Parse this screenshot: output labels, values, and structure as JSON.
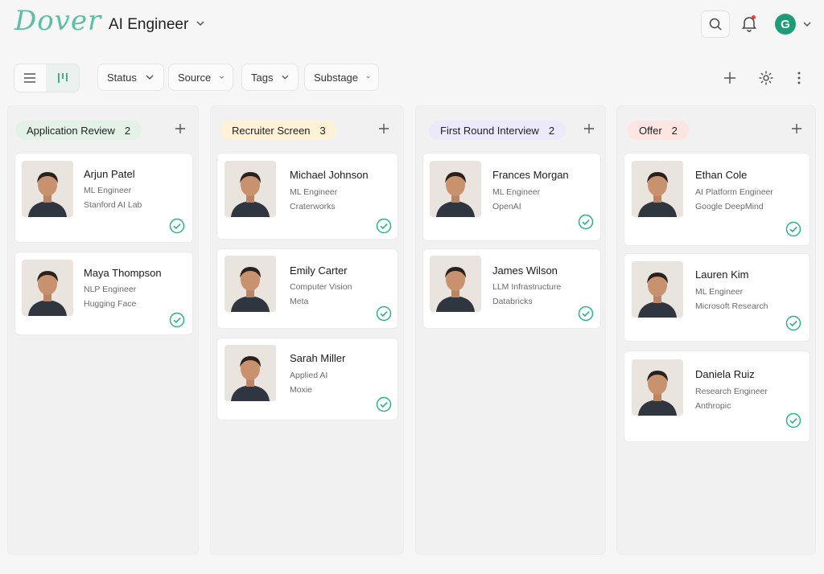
{
  "header": {
    "logo": "Dover",
    "job_title": "AI Engineer"
  },
  "user": {
    "initial": "G"
  },
  "filters": [
    {
      "label": "Status"
    },
    {
      "label": "Source"
    },
    {
      "label": "Tags"
    },
    {
      "label": "Substage"
    }
  ],
  "columns": [
    {
      "title": "Application Review",
      "count": "2",
      "color": "#e3f1e7",
      "candidates": [
        {
          "name": "Arjun Patel",
          "role": "ML Engineer",
          "org": "Stanford AI Lab"
        },
        {
          "name": "Maya Thompson",
          "role": "NLP Engineer",
          "org": "Hugging Face"
        }
      ]
    },
    {
      "title": "Recruiter Screen",
      "count": "3",
      "color": "#fdf2d8",
      "candidates": [
        {
          "name": "Michael Johnson",
          "role": "ML Engineer",
          "org": "Craterworks"
        },
        {
          "name": "Emily Carter",
          "role": "Computer Vision",
          "org": "Meta"
        },
        {
          "name": "Sarah Miller",
          "role": "Applied AI",
          "org": "Moxie"
        }
      ]
    },
    {
      "title": "First Round Interview",
      "count": "2",
      "color": "#ece9fb",
      "candidates": [
        {
          "name": "Frances Morgan",
          "role": "ML Engineer",
          "org": "OpenAI"
        },
        {
          "name": "James Wilson",
          "role": "LLM Infrastructure",
          "org": "Databricks"
        }
      ]
    },
    {
      "title": "Offer",
      "count": "2",
      "color": "#fde5e2",
      "candidates": [
        {
          "name": "Ethan Cole",
          "role": "AI Platform Engineer",
          "org": "Google DeepMind"
        },
        {
          "name": "Lauren Kim",
          "role": "ML Engineer",
          "org": "Microsoft Research"
        },
        {
          "name": "Daniela Ruiz",
          "role": "Research Engineer",
          "org": "Anthropic"
        }
      ]
    }
  ],
  "colors": {
    "accent": "#2fb08a",
    "brand": "#5cbfa5"
  }
}
